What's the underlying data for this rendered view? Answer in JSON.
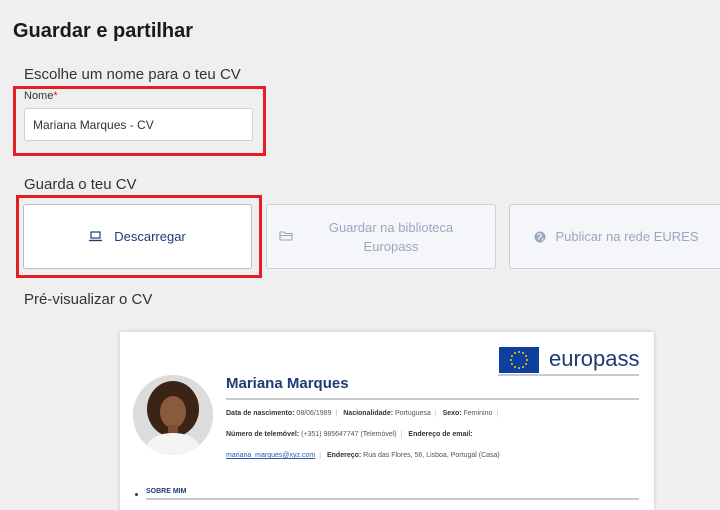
{
  "page": {
    "title": "Guardar e partilhar",
    "name_section": "Escolhe um nome para o teu CV",
    "save_section": "Guarda o teu CV",
    "preview_section": "Pré-visualizar o CV"
  },
  "name_field": {
    "label": "Nome",
    "required_mark": "*",
    "value": "Mariana Marques - CV"
  },
  "actions": {
    "download": "Descarregar",
    "library_line1": "Guardar na biblioteca",
    "library_line2": "Europass",
    "eures": "Publicar na rede EURES"
  },
  "icons": {
    "download": "laptop-icon",
    "library": "folder-icon",
    "eures": "globe-icon"
  },
  "cv_preview": {
    "brand": "europass",
    "name": "Mariana Marques",
    "birth_label": "Data de nascimento:",
    "birth_value": "08/06/1989",
    "nationality_label": "Nacionalidade:",
    "nationality_value": "Portuguesa",
    "sex_label": "Sexo:",
    "sex_value": "Feminino",
    "phone_label": "Número de telemóvel:",
    "phone_value": "(+351) 985647747 (Telemóvel)",
    "email_label": "Endereço de email:",
    "email_value": "mariana_marques@xyz.com",
    "address_label": "Endereço:",
    "address_value": "Rua das Flores, 56, Lisboa, Portugal (Casa)",
    "about_title": "SOBRE MIM"
  },
  "colors": {
    "highlight": "#e31e24",
    "europass_blue": "#1f3b73",
    "muted_button_text": "#9aa8bd"
  }
}
